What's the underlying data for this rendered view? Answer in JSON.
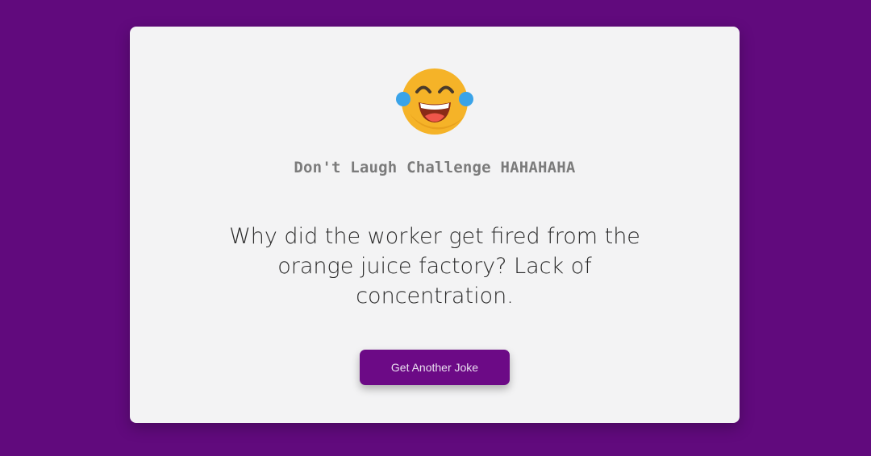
{
  "background_color": "#610a7d",
  "card": {
    "emoji_icon": "laughing-tears-emoji",
    "title": "Don't Laugh Challenge HAHAHAHA",
    "joke": "Why did the worker get fired from the orange juice factory? Lack of concentration.",
    "button_label": "Get Another Joke"
  },
  "colors": {
    "accent": "#6c0a86",
    "card": "#f3f3f4",
    "title_text": "#7b7b7b",
    "joke_text": "#2a2a2a"
  }
}
